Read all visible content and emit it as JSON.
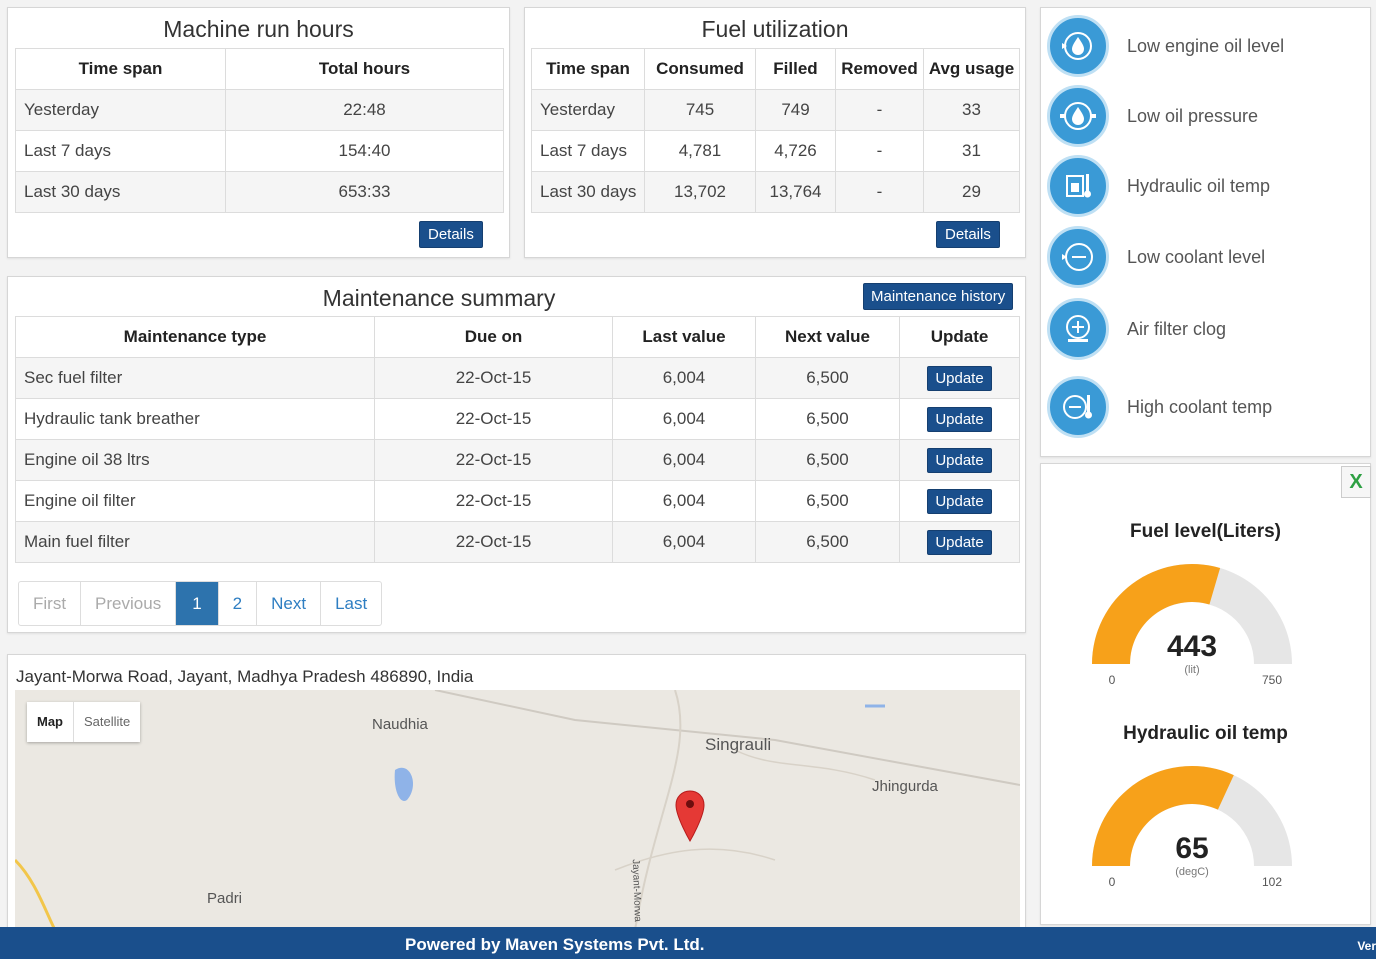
{
  "machine_run_hours": {
    "title": "Machine run hours",
    "headers": [
      "Time span",
      "Total hours"
    ],
    "rows": [
      [
        "Yesterday",
        "22:48"
      ],
      [
        "Last 7 days",
        "154:40"
      ],
      [
        "Last 30 days",
        "653:33"
      ]
    ],
    "details_label": "Details"
  },
  "fuel_utilization": {
    "title": "Fuel utilization",
    "headers": [
      "Time span",
      "Consumed",
      "Filled",
      "Removed",
      "Avg usage"
    ],
    "rows": [
      [
        "Yesterday",
        "745",
        "749",
        "-",
        "33"
      ],
      [
        "Last 7 days",
        "4,781",
        "4,726",
        "-",
        "31"
      ],
      [
        "Last 30 days",
        "13,702",
        "13,764",
        "-",
        "29"
      ]
    ],
    "details_label": "Details"
  },
  "maintenance": {
    "title": "Maintenance summary",
    "history_label": "Maintenance history",
    "headers": [
      "Maintenance type",
      "Due on",
      "Last value",
      "Next value",
      "Update"
    ],
    "rows": [
      [
        "Sec fuel filter",
        "22-Oct-15",
        "6,004",
        "6,500",
        "Update"
      ],
      [
        "Hydraulic tank breather",
        "22-Oct-15",
        "6,004",
        "6,500",
        "Update"
      ],
      [
        "Engine oil 38 ltrs",
        "22-Oct-15",
        "6,004",
        "6,500",
        "Update"
      ],
      [
        "Engine oil filter",
        "22-Oct-15",
        "6,004",
        "6,500",
        "Update"
      ],
      [
        "Main fuel filter",
        "22-Oct-15",
        "6,004",
        "6,500",
        "Update"
      ]
    ],
    "pagination": [
      "First",
      "Previous",
      "1",
      "2",
      "Next",
      "Last"
    ]
  },
  "map": {
    "address": "Jayant-Morwa Road, Jayant, Madhya Pradesh 486890, India",
    "tab_map": "Map",
    "tab_satellite": "Satellite",
    "places": [
      "Naudhia",
      "Singrauli",
      "Jhingurda",
      "Padri"
    ],
    "road_label": "Jayant-Morwa"
  },
  "alerts": [
    {
      "label": "Low engine oil level",
      "icon": "engine-oil-icon"
    },
    {
      "label": "Low oil pressure",
      "icon": "oil-pressure-icon"
    },
    {
      "label": "Hydraulic oil temp",
      "icon": "hydraulic-temp-icon"
    },
    {
      "label": "Low coolant level",
      "icon": "coolant-level-icon"
    },
    {
      "label": "Air filter clog",
      "icon": "air-filter-icon"
    },
    {
      "label": "High coolant temp",
      "icon": "coolant-temp-icon"
    }
  ],
  "gauges": {
    "close_label": "X",
    "fuel": {
      "title": "Fuel level(Liters)",
      "value": 443,
      "unit": "(lit)",
      "min": 0,
      "max": 750,
      "min_label": "0",
      "max_label": "750",
      "value_label": "443"
    },
    "hydraulic": {
      "title": "Hydraulic oil temp",
      "value": 65,
      "unit": "(degC)",
      "min": 0,
      "max": 102,
      "min_label": "0",
      "max_label": "102",
      "value_label": "65"
    }
  },
  "colors": {
    "primary": "#1a4f8c",
    "gauge_fill": "#f7a11a",
    "gauge_track": "#e6e6e6",
    "alert_icon": "#3a9ad6"
  },
  "footer": {
    "text": "Powered by Maven Systems Pvt. Ltd.",
    "version": "Ver"
  }
}
